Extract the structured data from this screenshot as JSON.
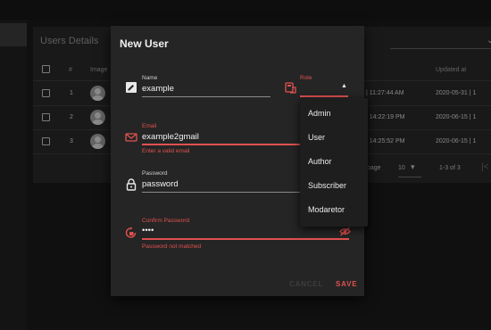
{
  "table": {
    "title": "Users Details",
    "columns": {
      "num": "#",
      "image": "Image",
      "updated": "Updated at"
    },
    "rows": [
      {
        "num": "1",
        "created_tail": "| 11:27:44 AM",
        "updated": "2020-05-31 | 1"
      },
      {
        "num": "2",
        "created_tail": "| 14:22:19 PM",
        "updated": "2020-06-15 | 1"
      },
      {
        "num": "3",
        "created_tail": "| 14:25:52 PM",
        "updated": "2020-06-15 | 1"
      }
    ],
    "pagination": {
      "rows_label": "page",
      "rows_value": "10",
      "range": "1-3 of 3"
    }
  },
  "dialog": {
    "title": "New User",
    "name": {
      "label": "Name",
      "value": "example"
    },
    "role": {
      "label": "Role"
    },
    "email": {
      "label": "Email",
      "value": "example2gmail",
      "error": "Enter a valid email"
    },
    "password": {
      "label": "Password",
      "value": "password"
    },
    "confirm": {
      "label": "Confirm Password",
      "value": "••••",
      "error": "Password not matched"
    },
    "actions": {
      "cancel": "CANCEL",
      "save": "SAVE"
    }
  },
  "role_menu": [
    "Admin",
    "User",
    "Author",
    "Subscriber",
    "Modaretor"
  ],
  "colors": {
    "error": "#e0514f",
    "surface": "#252525",
    "background": "#1a1a1a"
  },
  "icons": [
    "edit-icon",
    "role-badge-icon",
    "mail-icon",
    "lock-icon",
    "lock-reset-icon",
    "eye-off-icon",
    "chevron-down-icon",
    "caret-up-icon",
    "prev-page-icon"
  ]
}
